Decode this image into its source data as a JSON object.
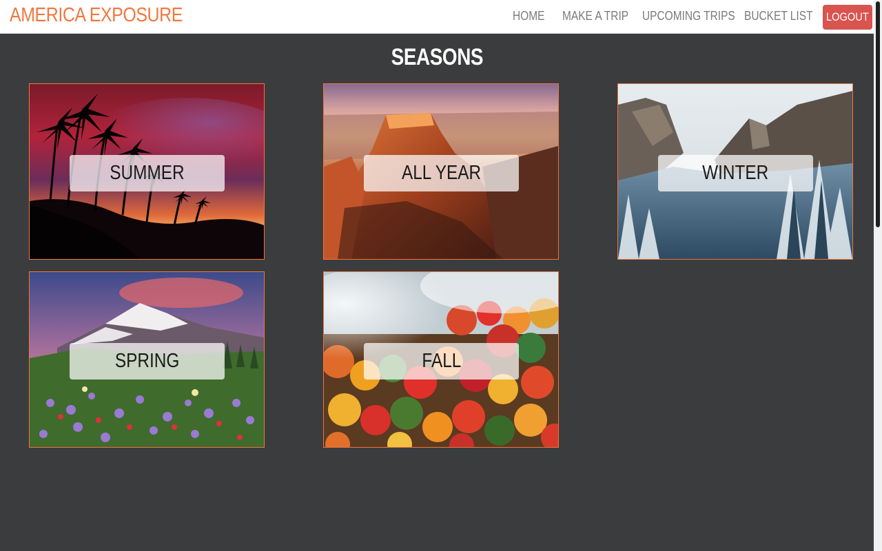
{
  "nav": {
    "brand": "AMERICA EXPOSURE",
    "links": [
      "HOME",
      "MAKE A TRIP",
      "UPCOMING TRIPS",
      "BUCKET LIST"
    ],
    "logout": "LOGOUT"
  },
  "main": {
    "title": "SEASONS",
    "seasons": [
      {
        "label": "SUMMER"
      },
      {
        "label": "ALL YEAR"
      },
      {
        "label": "WINTER"
      },
      {
        "label": "SPRING"
      },
      {
        "label": "FALL"
      }
    ]
  },
  "colors": {
    "accent": "#f0773f",
    "background": "#3b3c3e",
    "logout": "#d9534f"
  }
}
